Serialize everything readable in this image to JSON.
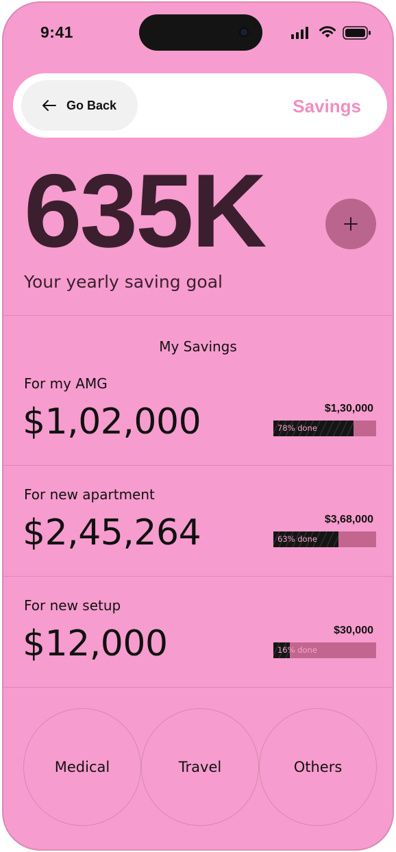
{
  "status_bar": {
    "time": "9:41",
    "icons": [
      "cellular-signal-icon",
      "wifi-icon",
      "battery-icon"
    ]
  },
  "header": {
    "back_label": "Go Back",
    "back_icon": "arrow-left-icon",
    "title": "Savings"
  },
  "goal": {
    "amount": "635K",
    "label": "Your yearly saving goal",
    "add_icon": "plus-icon"
  },
  "savings_section": {
    "title": "My Savings",
    "items": [
      {
        "label": "For my AMG",
        "amount": "$1,02,000",
        "target": "$1,30,000",
        "progress_label": "78% done",
        "progress": 0.78
      },
      {
        "label": "For new apartment",
        "amount": "$2,45,264",
        "target": "$3,68,000",
        "progress_label": "63% done",
        "progress": 0.63
      },
      {
        "label": "For new setup",
        "amount": "$12,000",
        "target": "$30,000",
        "progress_label": "16% done",
        "progress": 0.16
      }
    ]
  },
  "categories": [
    "Medical",
    "Travel",
    "Others"
  ],
  "colors": {
    "background": "#f79cce",
    "accent": "#ef8fc0",
    "goal_text": "#3b1f2e",
    "add_button": "#b9658e",
    "progress_track": "#c2668f"
  }
}
